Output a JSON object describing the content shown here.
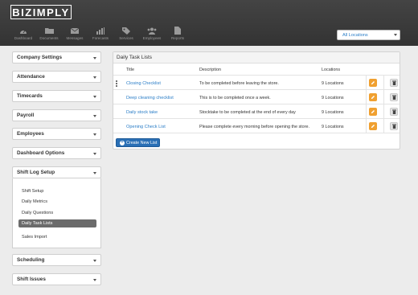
{
  "brand": {
    "logo_text": "BIZIMPLY"
  },
  "nav": [
    {
      "label": "Dashboard",
      "icon": "dashboard-icon"
    },
    {
      "label": "Documents",
      "icon": "folder-icon"
    },
    {
      "label": "Messages",
      "icon": "envelope-icon"
    },
    {
      "label": "Forecasts",
      "icon": "bar-chart-icon"
    },
    {
      "label": "Services",
      "icon": "tag-icon"
    },
    {
      "label": "Employees",
      "icon": "users-icon"
    },
    {
      "label": "Reports",
      "icon": "document-icon"
    }
  ],
  "location_select": {
    "value": "All Locations"
  },
  "sidebar": {
    "sections": [
      {
        "label": "Company Settings"
      },
      {
        "label": "Attendance"
      },
      {
        "label": "Timecards"
      },
      {
        "label": "Payroll"
      },
      {
        "label": "Employees"
      },
      {
        "label": "Dashboard Options"
      },
      {
        "label": "Shift Log Setup"
      },
      {
        "label": "Scheduling"
      },
      {
        "label": "Shift Issues"
      }
    ],
    "sub_items": [
      {
        "label": "Shift Setup"
      },
      {
        "label": "Daily Metrics"
      },
      {
        "label": "Daily Questions"
      },
      {
        "label": "Daily Task Lists"
      },
      {
        "label": "Sales Import"
      }
    ]
  },
  "main": {
    "title": "Daily Task Lists",
    "columns": {
      "title": "Title",
      "description": "Description",
      "locations": "Locations"
    },
    "rows": [
      {
        "title": "Closing Checklist",
        "description": "To be completed before leaving the store.",
        "locations": "9 Locations"
      },
      {
        "title": "Deep cleaning checklist",
        "description": "This is to be completed once a week.",
        "locations": "9 Locations"
      },
      {
        "title": "Daily stock take",
        "description": "Stocktake to be completed at the end of every day",
        "locations": "9 Locations"
      },
      {
        "title": "Opening Check List",
        "description": "Please complete every morning before opening the store.",
        "locations": "9 Locations"
      }
    ],
    "create_button": "Create New List"
  },
  "colors": {
    "accent": "#2a7dc7",
    "edit": "#f0a030",
    "header": "#3a3a3a",
    "active_item": "#6b6b6b"
  }
}
